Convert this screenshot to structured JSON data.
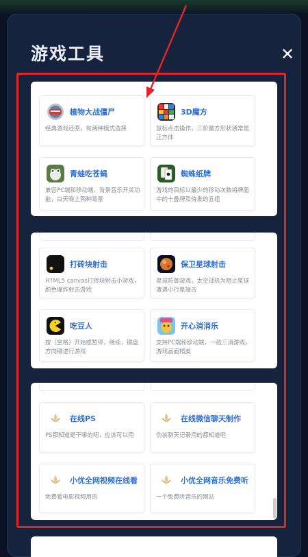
{
  "modal": {
    "title": "游戏工具",
    "close_label": "✕"
  },
  "colors": {
    "background": "#0b1223",
    "modal": "#15233d",
    "accent_title": "#2f6fd8",
    "highlight_frame": "#e0262b"
  },
  "panels": [
    {
      "cards": [
        {
          "title": "植物大战僵尸",
          "desc": "经典游戏还原，有两种模式选择",
          "icon": "pvz-icon"
        },
        {
          "title": "3D魔方",
          "desc": "鼠标点击操作，三阶魔方形状通常是正方体",
          "icon": "rubiks-cube-icon"
        },
        {
          "title": "青蛙吃苍蝇",
          "desc": "兼容PC端和移动端，背景音乐开关功能，白天晚上两种背景",
          "icon": "frog-icon"
        },
        {
          "title": "蜘蛛纸牌",
          "desc": "游戏的目标以最少的移动次数将牌面中的十叠牌及待发的五组",
          "icon": "spider-cards-icon"
        }
      ]
    },
    {
      "cards": [
        {
          "title": "打砖块射击",
          "desc": "HTML5 canvas打砖块射击小游戏，颜色爆炸射击游戏",
          "icon": "breakout-icon"
        },
        {
          "title": "保卫星球射击",
          "desc": "星球防御游戏，太空战机为阻止星球遭遇小行星撞击",
          "icon": "planet-icon"
        },
        {
          "title": "吃豆人",
          "desc": "按［空格］开始或暂停，继续，键盘方向键进行游戏",
          "icon": "pacman-icon"
        },
        {
          "title": "开心消消乐",
          "desc": "支持PC端和移动端，一款三消游戏，游戏画面精美",
          "icon": "match3-icon"
        }
      ]
    },
    {
      "cards": [
        {
          "title": "在线PS",
          "desc": "PS都知道是干嘛的吧，应该可以用",
          "icon": "lotus-icon"
        },
        {
          "title": "在线微信聊天制作",
          "desc": "伪装聊天记录用的都知道吧",
          "icon": "lotus-icon"
        },
        {
          "title": "小优全网视频在线看",
          "desc": "免费看电影视频用的",
          "icon": "lotus-icon"
        },
        {
          "title": "小优全网音乐免费听",
          "desc": "一个免费听音乐的网站",
          "icon": "lotus-icon"
        }
      ]
    }
  ]
}
